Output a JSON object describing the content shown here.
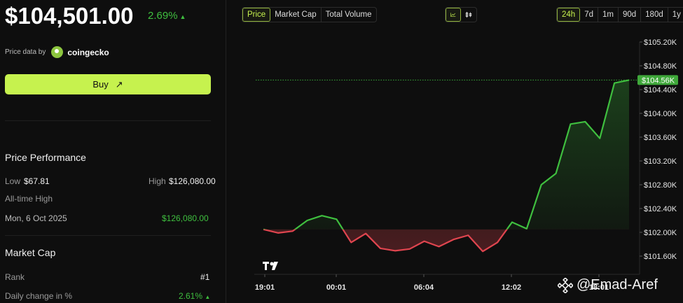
{
  "header": {
    "price": "$104,501.00",
    "change": "2.69%",
    "change_arrow": "▲",
    "price_data_by": "Price data by",
    "provider": "coingecko"
  },
  "buy": {
    "label": "Buy",
    "arrow": "↗"
  },
  "performance": {
    "title": "Price Performance",
    "low_label": "Low",
    "low_value": "$67.81",
    "high_label": "High",
    "high_value": "$126,080.00",
    "ath_label": "All-time High",
    "ath_date": "Mon, 6 Oct 2025",
    "ath_value": "$126,080.00"
  },
  "market_cap": {
    "title": "Market Cap",
    "rank_label": "Rank",
    "rank_value": "#1",
    "daily_change_label": "Daily change in %",
    "daily_change_value": "2.61%",
    "daily_change_arrow": "▲"
  },
  "tabs": {
    "metric": [
      "Price",
      "Market Cap",
      "Total Volume"
    ],
    "metric_active": "Price",
    "chart_type_icons": [
      "line-chart-icon",
      "candlestick-icon"
    ],
    "ranges": [
      "24h",
      "7d",
      "1m",
      "90d",
      "180d",
      "1y"
    ],
    "range_active": "24h"
  },
  "colors": {
    "accent": "#c6f24e",
    "up": "#3fbf3f",
    "down": "#e0454f",
    "current_badge": "#3fa83a"
  },
  "watermark": "@Emad-Aref",
  "chart_logo": "TV",
  "chart_data": {
    "type": "line",
    "ylim": [
      101400,
      105300
    ],
    "y_ticks": [
      101600,
      102000,
      102400,
      102800,
      103200,
      103600,
      104000,
      104400,
      104800,
      105200
    ],
    "y_tick_labels": [
      "$101.60K",
      "$102.00K",
      "$102.40K",
      "$102.80K",
      "$103.20K",
      "$103.60K",
      "$104.00K",
      "$104.40K",
      "$104.80K",
      "$105.20K"
    ],
    "x_tick_labels": [
      "19:01",
      "00:01",
      "06:04",
      "12:02",
      "18:01"
    ],
    "baseline": 102050,
    "current_value": 104560,
    "current_label": "$104.56K",
    "points": [
      102050,
      101990,
      102020,
      102200,
      102280,
      102220,
      101830,
      101980,
      101730,
      101690,
      101720,
      101850,
      101760,
      101880,
      101950,
      101680,
      101830,
      102170,
      102060,
      102800,
      102990,
      103820,
      103860,
      103580,
      104510,
      104560
    ]
  }
}
